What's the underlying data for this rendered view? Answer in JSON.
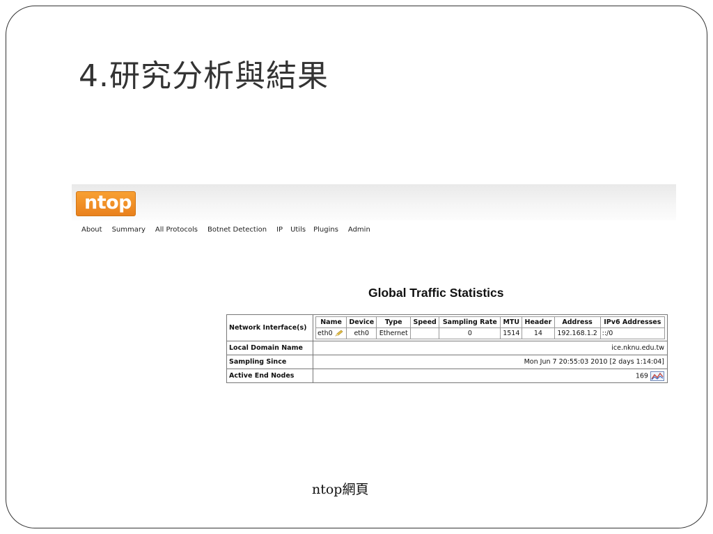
{
  "slide": {
    "title": "4.研究分析與結果",
    "caption": "ntop網頁"
  },
  "app": {
    "logo_text": "ntop",
    "brand_color": "#ef8a22"
  },
  "nav": [
    {
      "label": "About"
    },
    {
      "label": "Summary"
    },
    {
      "label": "All Protocols"
    },
    {
      "label": "Botnet Detection"
    },
    {
      "label": "IP"
    },
    {
      "label": "Utils"
    },
    {
      "label": "Plugins"
    },
    {
      "label": "Admin"
    }
  ],
  "stats": {
    "title": "Global Traffic Statistics",
    "interfaces_label": "Network Interface(s)",
    "columns": [
      "Name",
      "Device",
      "Type",
      "Speed",
      "Sampling Rate",
      "MTU",
      "Header",
      "Address",
      "IPv6 Addresses"
    ],
    "interface_row": {
      "name": "eth0",
      "device": "eth0",
      "type": "Ethernet",
      "speed": "",
      "sampling_rate": "0",
      "mtu": "1514",
      "header": "14",
      "address": "192.168.1.2",
      "ipv6": "::/0"
    },
    "rows": [
      {
        "label": "Local Domain Name",
        "value": "ice.nknu.edu.tw"
      },
      {
        "label": "Sampling Since",
        "value": "Mon Jun 7 20:55:03 2010 [2 days 1:14:04]"
      },
      {
        "label": "Active End Nodes",
        "value": "169"
      }
    ]
  }
}
